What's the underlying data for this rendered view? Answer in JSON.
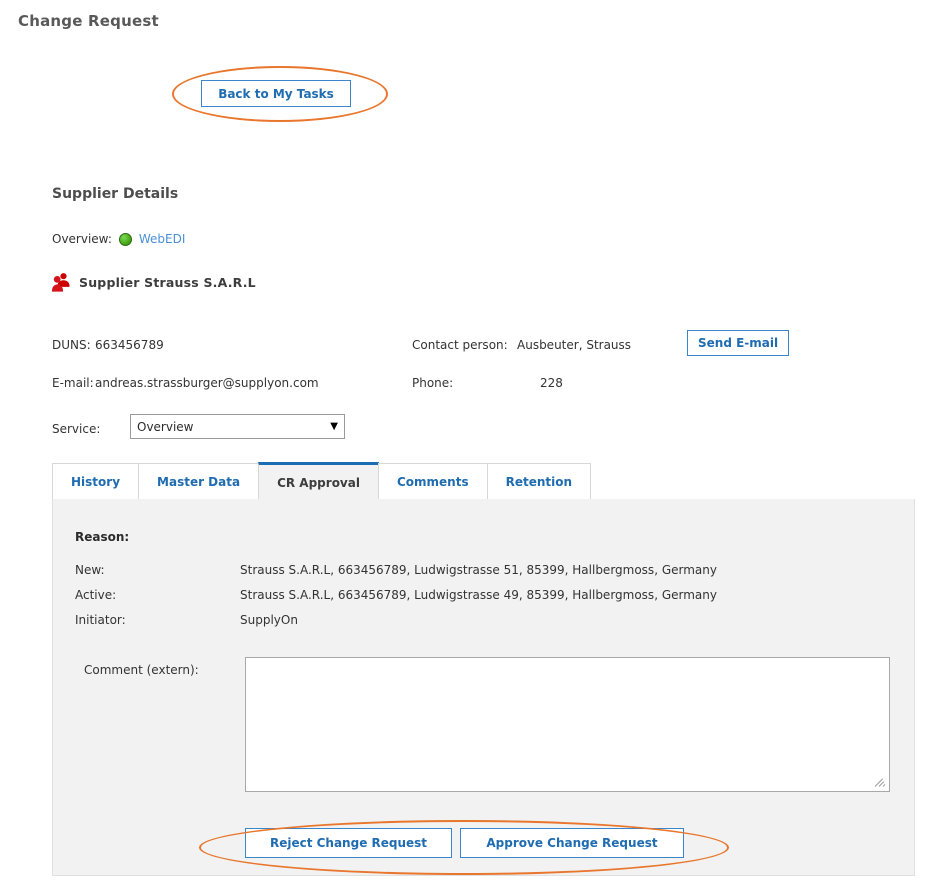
{
  "page": {
    "title": "Change Request"
  },
  "toolbar": {
    "back_label": "Back to My Tasks"
  },
  "supplier": {
    "section_title": "Supplier Details",
    "overview_label": "Overview:",
    "overview_status_icon": "green-status-circle-icon",
    "overview_link": "WebEDI",
    "supplier_icon": "people-icon",
    "name": "Supplier Strauss S.A.R.L",
    "duns_label": "DUNS:",
    "duns_value": "663456789",
    "contact_label": "Contact person:",
    "contact_value": "Ausbeuter, Strauss",
    "send_email_label": "Send E-mail",
    "email_label": "E-mail:",
    "email_value": "andreas.strassburger@supplyon.com",
    "phone_label": "Phone:",
    "phone_value": "228"
  },
  "service": {
    "label": "Service:",
    "selected": "Overview",
    "caret_icon": "chevron-down-icon",
    "options": [
      "Overview"
    ]
  },
  "tabs": [
    {
      "label": "History",
      "active": false
    },
    {
      "label": "Master Data",
      "active": false
    },
    {
      "label": "CR Approval",
      "active": true
    },
    {
      "label": "Comments",
      "active": false
    },
    {
      "label": "Retention",
      "active": false
    }
  ],
  "cr_approval": {
    "reason_heading": "Reason:",
    "new_label": "New:",
    "new_value": "Strauss S.A.R.L, 663456789, Ludwigstrasse 51, 85399, Hallbergmoss, Germany",
    "active_label": "Active:",
    "active_value": "Strauss S.A.R.L, 663456789, Ludwigstrasse 49, 85399, Hallbergmoss, Germany",
    "initiator_label": "Initiator:",
    "initiator_value": "SupplyOn",
    "comment_label": "Comment (extern):",
    "comment_value": "",
    "comment_placeholder": "",
    "reject_label": "Reject Change Request",
    "approve_label": "Approve Change Request"
  },
  "annotations": {
    "highlight_color": "#e8762c",
    "ellipse_back_label": "highlight-back-to-my-tasks",
    "ellipse_actions_label": "highlight-approval-actions"
  },
  "colors": {
    "link": "#4a90d9",
    "button_text": "#1f6cb0",
    "button_border": "#3b86c8",
    "tab_active_bar": "#1b6cb0",
    "panel_bg": "#f2f2f2",
    "status_green": "#4caf1e",
    "supplier_icon_red": "#cc0000"
  }
}
